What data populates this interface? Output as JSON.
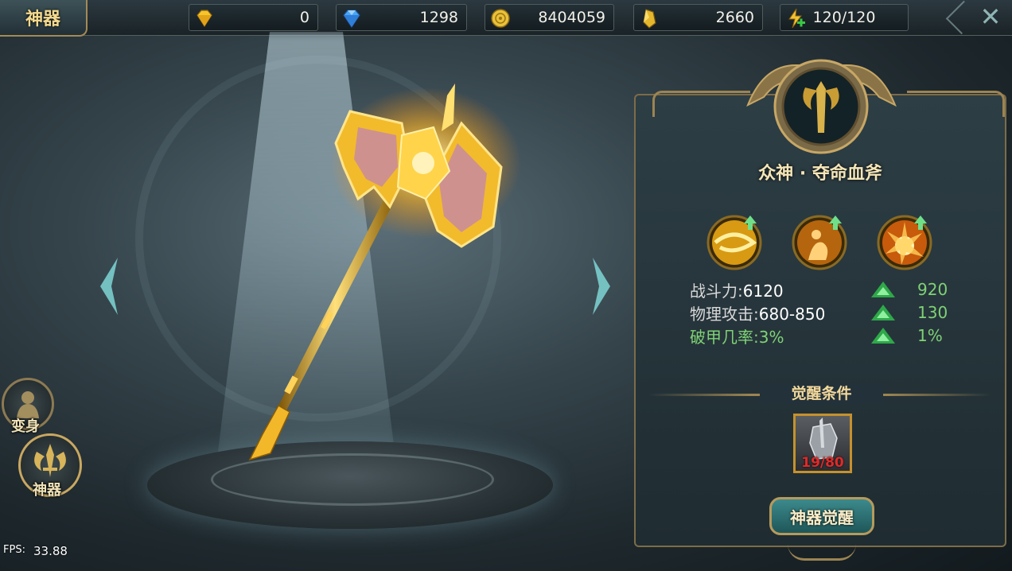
{
  "header": {
    "title": "神器",
    "resources": [
      {
        "name": "gold-diamond",
        "value": "0",
        "color": "#f2c12e"
      },
      {
        "name": "blue-diamond",
        "value": "1298",
        "color": "#3f9cf0"
      },
      {
        "name": "gold-coin",
        "value": "8404059",
        "color": "#e9c23a"
      },
      {
        "name": "gold-crystal",
        "value": "2660",
        "color": "#e5b72c"
      },
      {
        "name": "energy",
        "value": "120/120",
        "color": "#f0c030"
      }
    ]
  },
  "side_buttons": {
    "transform": "变身",
    "artifact": "神器"
  },
  "fps": {
    "label": "FPS:",
    "value": "33.88"
  },
  "panel": {
    "weapon_name": "众神 · 夺命血斧",
    "stats": [
      {
        "label": "战斗力:",
        "value": "6120",
        "increase": "920"
      },
      {
        "label": "物理攻击:",
        "value": "680-850",
        "increase": "130"
      },
      {
        "label": "破甲几率:",
        "value": "3%",
        "increase": "1%"
      }
    ],
    "awaken_condition_title": "觉醒条件",
    "material_count": "19/80",
    "awaken_button": "神器觉醒"
  }
}
